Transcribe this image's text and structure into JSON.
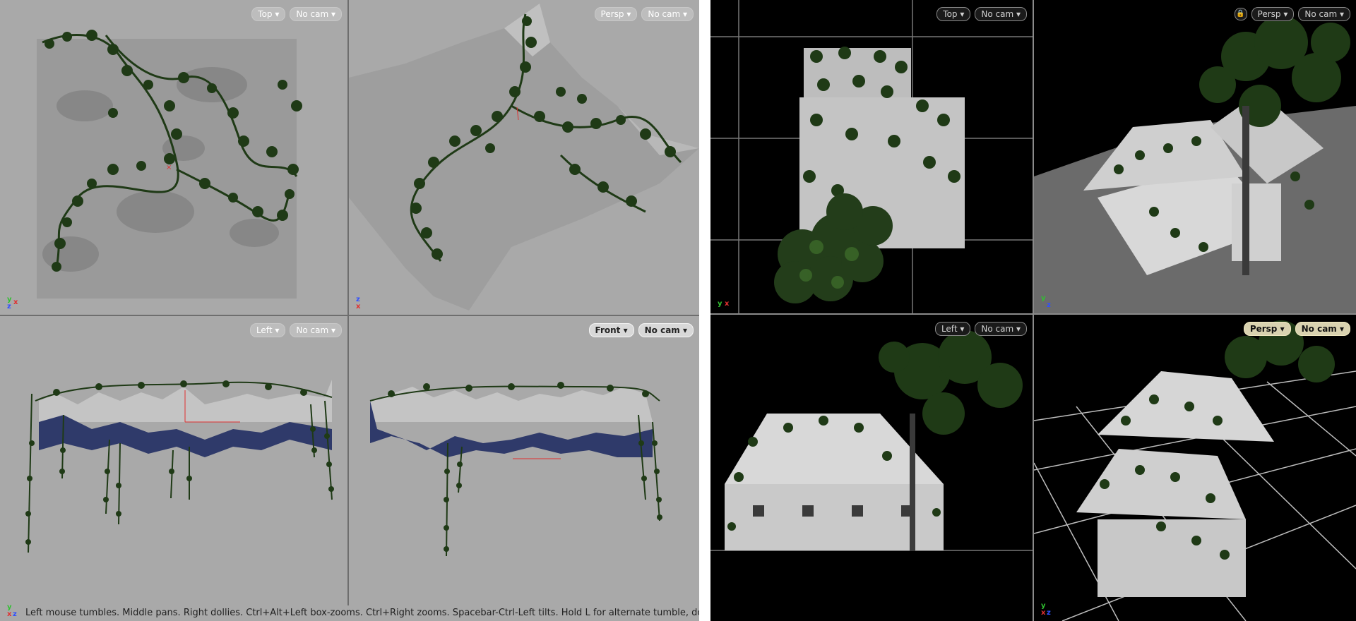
{
  "left_panel": {
    "viewports": [
      {
        "view_label": "Top",
        "cam_label": "No cam",
        "active": false,
        "axes": [
          "y",
          "x",
          "z"
        ]
      },
      {
        "view_label": "Persp",
        "cam_label": "No cam",
        "active": false,
        "axes": [
          "z",
          "x"
        ]
      },
      {
        "view_label": "Left",
        "cam_label": "No cam",
        "active": false,
        "axes": []
      },
      {
        "view_label": "Front",
        "cam_label": "No cam",
        "active": true,
        "axes": []
      }
    ],
    "status_text": "Left mouse tumbles. Middle pans. Right dollies. Ctrl+Alt+Left box-zooms. Ctrl+Right zooms. Spacebar-Ctrl-Left tilts. Hold L for alternate tumble, dolly, and zoom.",
    "status_axes": [
      "y",
      "x",
      "z"
    ]
  },
  "right_panel": {
    "viewports": [
      {
        "view_label": "Top",
        "cam_label": "No cam",
        "active": false,
        "axes": [
          "y",
          "x"
        ]
      },
      {
        "view_label": "Persp",
        "cam_label": "No cam",
        "active": false,
        "axes": [
          "y",
          "z"
        ]
      },
      {
        "view_label": "Left",
        "cam_label": "No cam",
        "active": false,
        "axes": []
      },
      {
        "view_label": "Persp",
        "cam_label": "No cam",
        "active": true,
        "axes": [
          "y",
          "x",
          "z"
        ]
      }
    ]
  },
  "colors": {
    "left_bg": "#a9a9a9",
    "right_bg": "#000000",
    "foliage": "#1f3a16",
    "water": "#2f3a6a",
    "axis_x": "#e03030",
    "axis_y": "#30c030",
    "axis_z": "#3050ff"
  }
}
